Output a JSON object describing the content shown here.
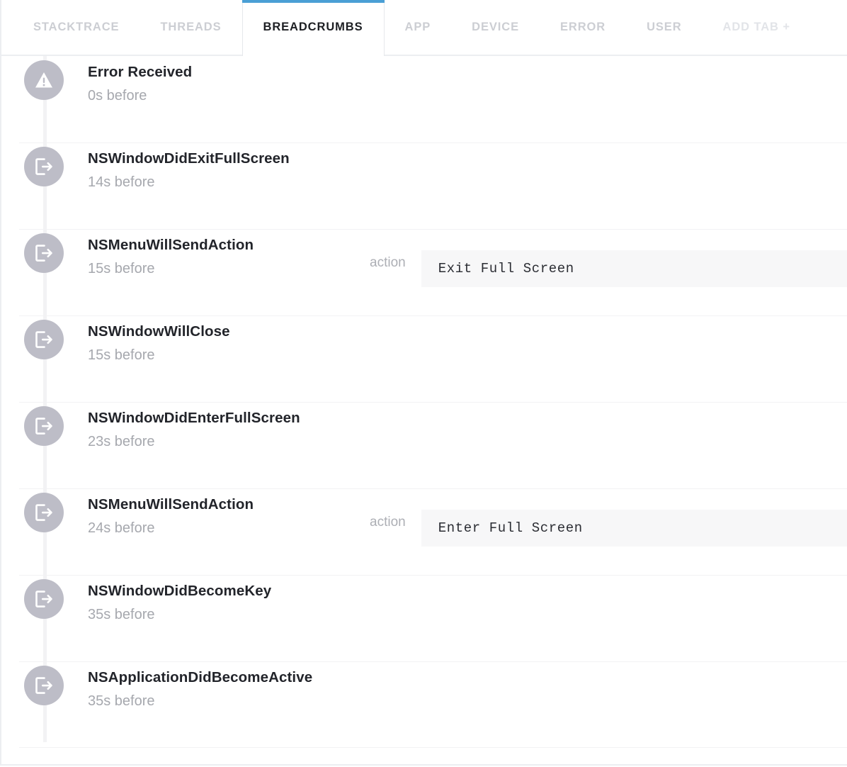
{
  "tabs": [
    {
      "label": "STACKTRACE",
      "state": "inactive"
    },
    {
      "label": "THREADS",
      "state": "inactive"
    },
    {
      "label": "BREADCRUMBS",
      "state": "active"
    },
    {
      "label": "APP",
      "state": "inactive"
    },
    {
      "label": "DEVICE",
      "state": "inactive"
    },
    {
      "label": "ERROR",
      "state": "inactive"
    },
    {
      "label": "USER",
      "state": "inactive"
    },
    {
      "label": "ADD TAB +",
      "state": "muted"
    }
  ],
  "colors": {
    "active_tab_underline": "#4a9fd5",
    "active_tab_text": "#1d1f23",
    "inactive_tab_text": "#ccced3",
    "add_tab_text": "#e2e4e8",
    "badge": "#bdbdc7",
    "title": "#22242a",
    "timestamp": "#a6a8ae",
    "detail_key": "#adafb5",
    "detail_value_bg": "#f7f7f8",
    "rail": "#f2f2f4",
    "separator": "#f2f2f4",
    "card_border": "#eceef1"
  },
  "breadcrumbs": [
    {
      "icon": "warning-triangle-icon",
      "title": "Error Received",
      "time": "0s before",
      "detail_key": "",
      "detail_value": ""
    },
    {
      "icon": "exit-arrow-icon",
      "title": "NSWindowDidExitFullScreen",
      "time": "14s before",
      "detail_key": "",
      "detail_value": ""
    },
    {
      "icon": "exit-arrow-icon",
      "title": "NSMenuWillSendAction",
      "time": "15s before",
      "detail_key": "action",
      "detail_value": "Exit Full Screen"
    },
    {
      "icon": "exit-arrow-icon",
      "title": "NSWindowWillClose",
      "time": "15s before",
      "detail_key": "",
      "detail_value": ""
    },
    {
      "icon": "exit-arrow-icon",
      "title": "NSWindowDidEnterFullScreen",
      "time": "23s before",
      "detail_key": "",
      "detail_value": ""
    },
    {
      "icon": "exit-arrow-icon",
      "title": "NSMenuWillSendAction",
      "time": "24s before",
      "detail_key": "action",
      "detail_value": "Enter Full Screen"
    },
    {
      "icon": "exit-arrow-icon",
      "title": "NSWindowDidBecomeKey",
      "time": "35s before",
      "detail_key": "",
      "detail_value": ""
    },
    {
      "icon": "exit-arrow-icon",
      "title": "NSApplicationDidBecomeActive",
      "time": "35s before",
      "detail_key": "",
      "detail_value": ""
    }
  ]
}
